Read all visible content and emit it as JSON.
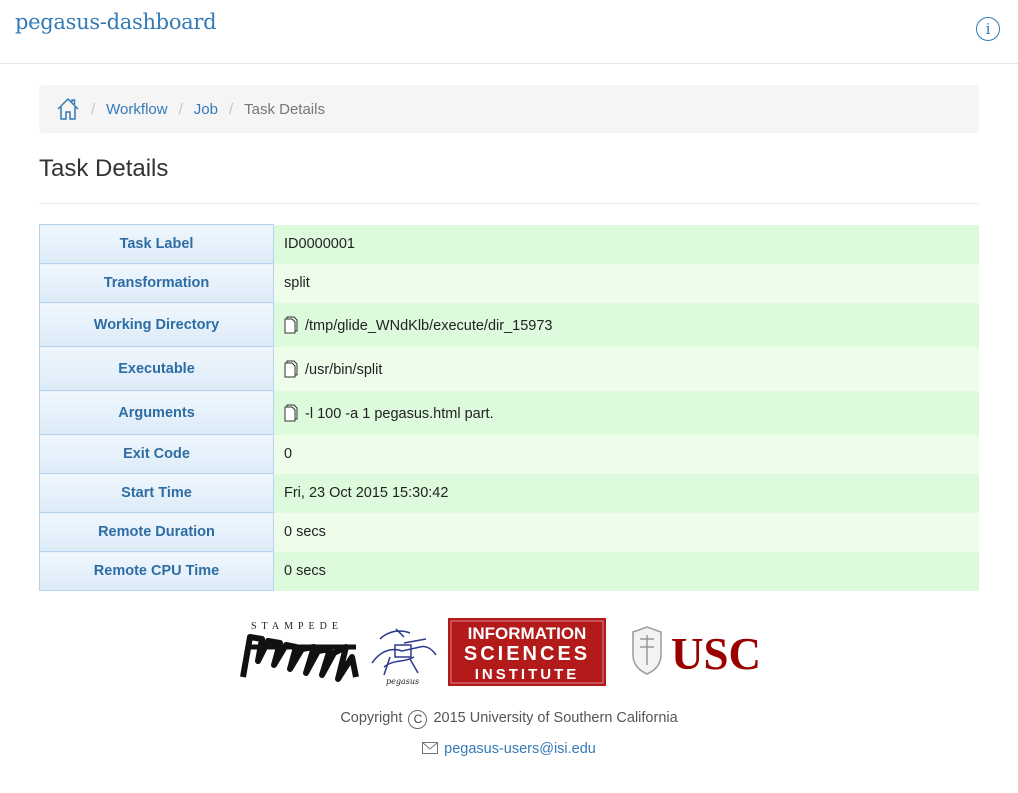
{
  "navbar": {
    "brand": "pegasus-dashboard",
    "info_icon": "info-circle-icon",
    "info_label": "i"
  },
  "breadcrumb": {
    "home_icon": "home-icon",
    "items": [
      {
        "label": "Workflow"
      },
      {
        "label": "Job"
      },
      {
        "label": "Task Details"
      }
    ],
    "separator": "/"
  },
  "page": {
    "title": "Task Details"
  },
  "details": {
    "rows": [
      {
        "label": "Task Label",
        "value": "ID0000001"
      },
      {
        "label": "Transformation",
        "value": "split"
      },
      {
        "label": "Working Directory",
        "value": "/tmp/glide_WNdKlb/execute/dir_15973",
        "icon": "file-copy-icon"
      },
      {
        "label": "Executable",
        "value": "/usr/bin/split",
        "icon": "file-copy-icon"
      },
      {
        "label": "Arguments",
        "value": "-l 100 -a 1 pegasus.html part.",
        "icon": "file-copy-icon"
      },
      {
        "label": "Exit Code",
        "value": "0"
      },
      {
        "label": "Start Time",
        "value": "Fri, 23 Oct 2015 15:30:42"
      },
      {
        "label": "Remote Duration",
        "value": "0 secs"
      },
      {
        "label": "Remote CPU Time",
        "value": "0 secs"
      }
    ]
  },
  "footer": {
    "logos": {
      "stampede": "STAMPEDE",
      "pegasus": "pegasus",
      "isi": [
        "INFORMATION",
        "SCIENCES",
        "INSTITUTE"
      ],
      "usc": "USC"
    },
    "copyright_prefix": "Copyright",
    "copyright_symbol": "C",
    "copyright_text": "2015 University of Southern California",
    "email": "pegasus-users@isi.edu",
    "mail_icon": "envelope-icon"
  },
  "colors": {
    "link": "#337ab7",
    "header_cell": "#dcebf8",
    "row_even": "#ddfadd",
    "row_odd": "#edfdea",
    "isi_red": "#b31b1b",
    "usc_cardinal": "#990000"
  }
}
